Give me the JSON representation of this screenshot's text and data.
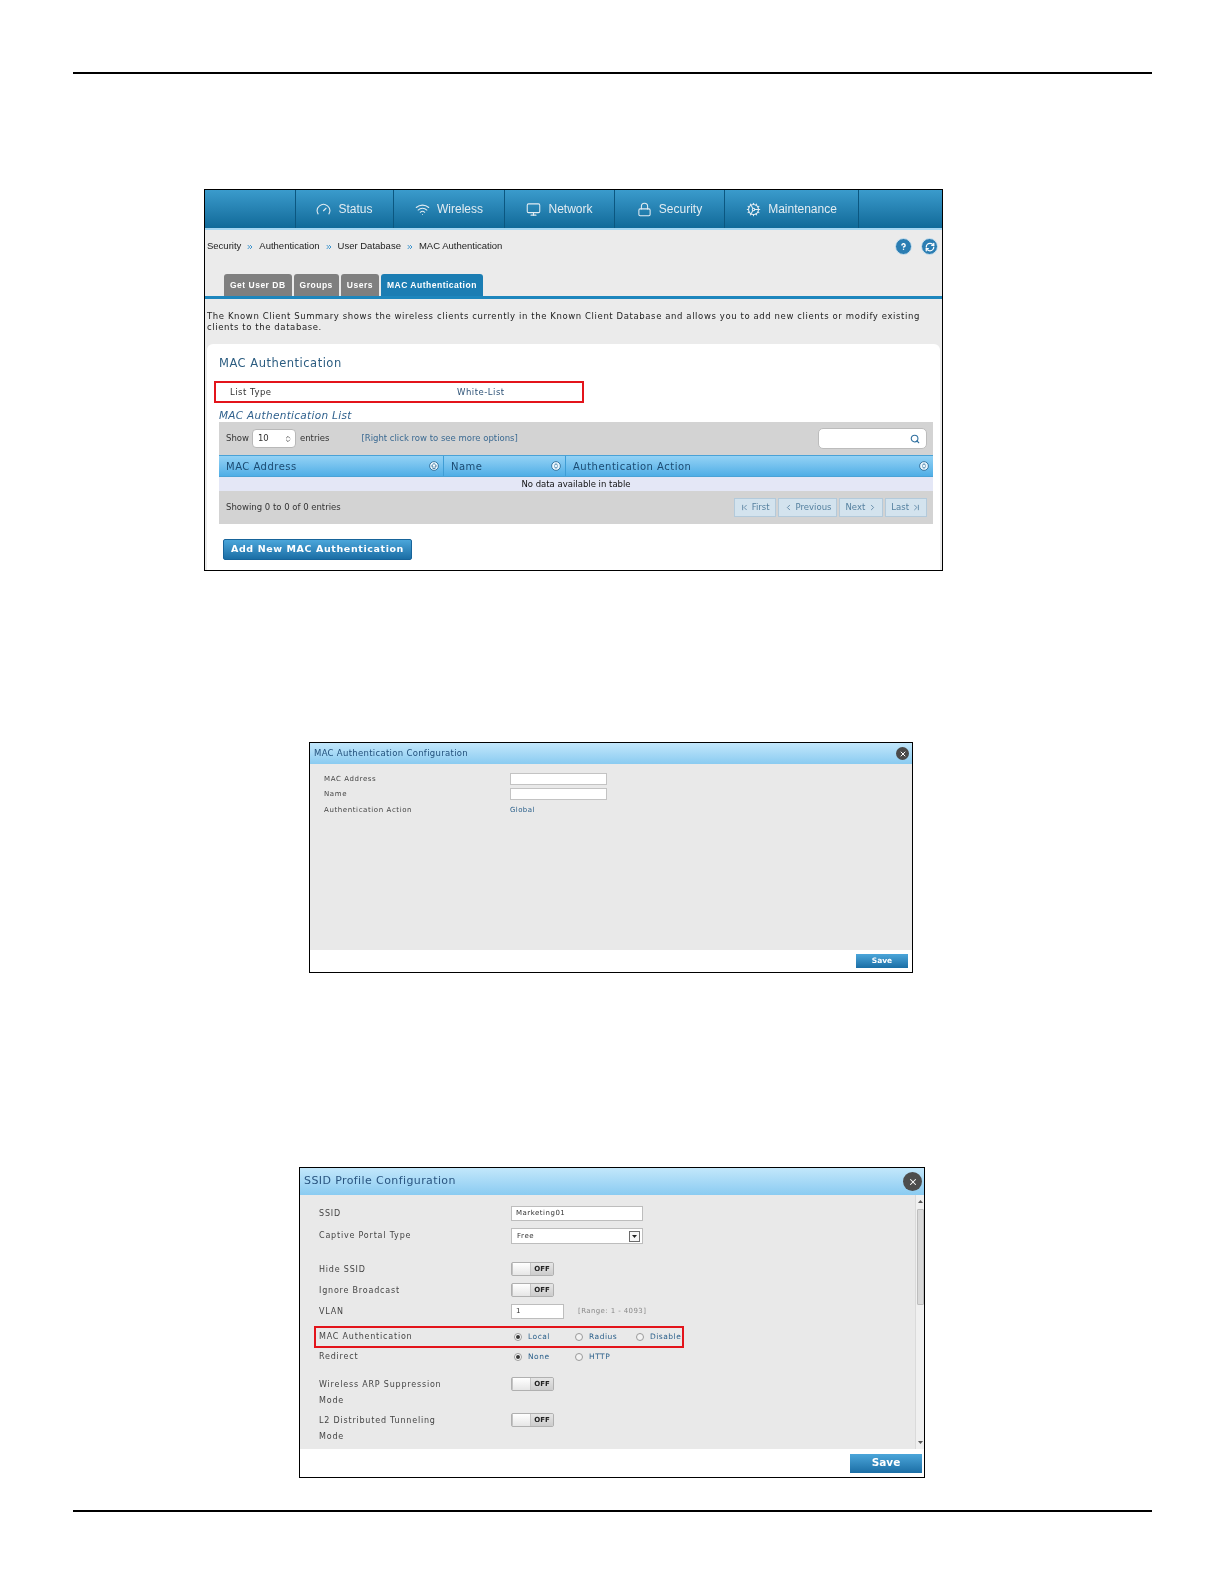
{
  "mac_list_screen": {
    "nav": [
      {
        "label": "Status"
      },
      {
        "label": "Wireless"
      },
      {
        "label": "Network"
      },
      {
        "label": "Security"
      },
      {
        "label": "Maintenance"
      }
    ],
    "breadcrumb": [
      "Security",
      "Authentication",
      "User Database",
      "MAC Authentication"
    ],
    "tabs": [
      {
        "label": "Get User DB",
        "selected": false
      },
      {
        "label": "Groups",
        "selected": false
      },
      {
        "label": "Users",
        "selected": false
      },
      {
        "label": "MAC Authentication",
        "selected": true
      }
    ],
    "description": "The Known Client Summary shows the wireless clients currently in the Known Client Database and allows you to add new clients or modify existing clients to the database.",
    "section_title": "MAC Authentication",
    "list_type": {
      "label": "List Type",
      "value": "White-List",
      "highlighted": true
    },
    "list_title": "MAC Authentication List",
    "table": {
      "show_label": "Show",
      "page_size": "10",
      "entries_label": "entries",
      "hint": "[Right click row to see more options]",
      "columns": [
        {
          "label": "MAC Address",
          "sorted": true
        },
        {
          "label": "Name",
          "sorted": false
        },
        {
          "label": "Authentication Action",
          "sorted": false
        }
      ],
      "empty_message": "No data available in table",
      "summary": "Showing 0 to 0 of 0 entries",
      "pager": [
        {
          "label": "First",
          "disabled": true
        },
        {
          "label": "Previous",
          "disabled": true
        },
        {
          "label": "Next",
          "disabled": true
        },
        {
          "label": "Last",
          "disabled": true
        }
      ]
    },
    "add_button": "Add New MAC Authentication"
  },
  "mac_config_dialog": {
    "title": "MAC Authentication Configuration",
    "fields": [
      {
        "kind": "input",
        "label": "MAC Address"
      },
      {
        "kind": "input",
        "label": "Name"
      },
      {
        "kind": "text",
        "label": "Authentication Action",
        "value": "Global"
      }
    ],
    "save_button": "Save"
  },
  "ssid_dialog": {
    "title": "SSID Profile Configuration",
    "fields": [
      {
        "kind": "input",
        "label": "SSID",
        "value": "Marketing01",
        "highlighted": false
      },
      {
        "kind": "select",
        "label": "Captive Portal Type",
        "value": "Free",
        "highlighted": false
      },
      {
        "kind": "toggle",
        "label": "Hide SSID",
        "on": false,
        "state_label": "OFF",
        "highlighted": false
      },
      {
        "kind": "toggle",
        "label": "Ignore Broadcast",
        "on": false,
        "state_label": "OFF",
        "highlighted": false
      },
      {
        "kind": "input",
        "label": "VLAN",
        "value": "1",
        "hint": "[Range: 1 - 4093]",
        "highlighted": false
      },
      {
        "kind": "radio",
        "label": "MAC Authentication",
        "options": [
          {
            "label": "Local",
            "selected": true
          },
          {
            "label": "Radius",
            "selected": false
          },
          {
            "label": "Disable",
            "selected": false
          }
        ],
        "highlighted": true
      },
      {
        "kind": "radio",
        "label": "Redirect",
        "options": [
          {
            "label": "None",
            "selected": true
          },
          {
            "label": "HTTP",
            "selected": false
          }
        ],
        "highlighted": false
      },
      {
        "kind": "toggle",
        "label": "Wireless ARP Suppression Mode",
        "on": false,
        "state_label": "OFF",
        "highlighted": false
      },
      {
        "kind": "toggle",
        "label": "L2 Distributed Tunneling Mode",
        "on": false,
        "state_label": "OFF",
        "highlighted": false
      }
    ],
    "save_button": "Save"
  }
}
